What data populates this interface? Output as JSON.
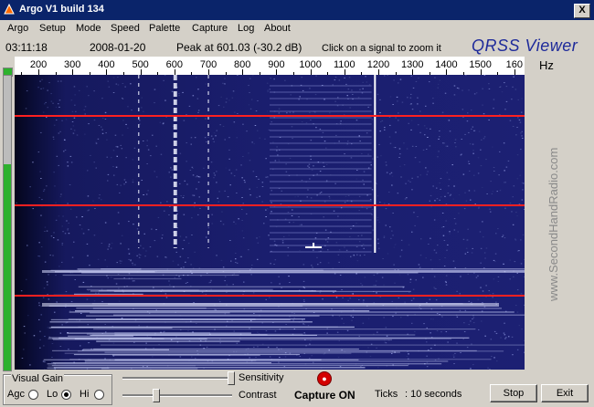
{
  "window": {
    "title": "Argo V1 build 134",
    "close_label": "X"
  },
  "menu": [
    "Argo",
    "Setup",
    "Mode",
    "Speed",
    "Palette",
    "Capture",
    "Log",
    "About"
  ],
  "status": {
    "time": "03:11:18",
    "date": "2008-01-20",
    "peak": "Peak at 601.03 (-30.2 dB)",
    "hint": "Click on a signal to zoom it",
    "logo": "QRSS Viewer",
    "unit": "Hz"
  },
  "ruler": {
    "labels": [
      "200",
      "300",
      "400",
      "500",
      "600",
      "700",
      "800",
      "900",
      "1000",
      "1100",
      "1200",
      "1300",
      "1400",
      "1500",
      "160"
    ],
    "min_hz": 130,
    "max_hz": 1630
  },
  "spectrogram": {
    "marker_color": "#ff2020",
    "signal_freqs_hz": [
      495,
      600,
      605,
      700,
      1190
    ],
    "level_percent": 70
  },
  "watermark": "www.SecondHandRadio.com",
  "controls": {
    "visual_gain_title": "Visual Gain",
    "agc_label": "Agc",
    "lo_label": "Lo",
    "hi_label": "Hi",
    "selected_gain": "Lo",
    "sensitivity_label": "Sensitivity",
    "contrast_label": "Contrast",
    "capture_status": "Capture ON",
    "ticks_label": "Ticks",
    "ticks_value": ": 10 seconds",
    "stop_label": "Stop",
    "exit_label": "Exit"
  }
}
